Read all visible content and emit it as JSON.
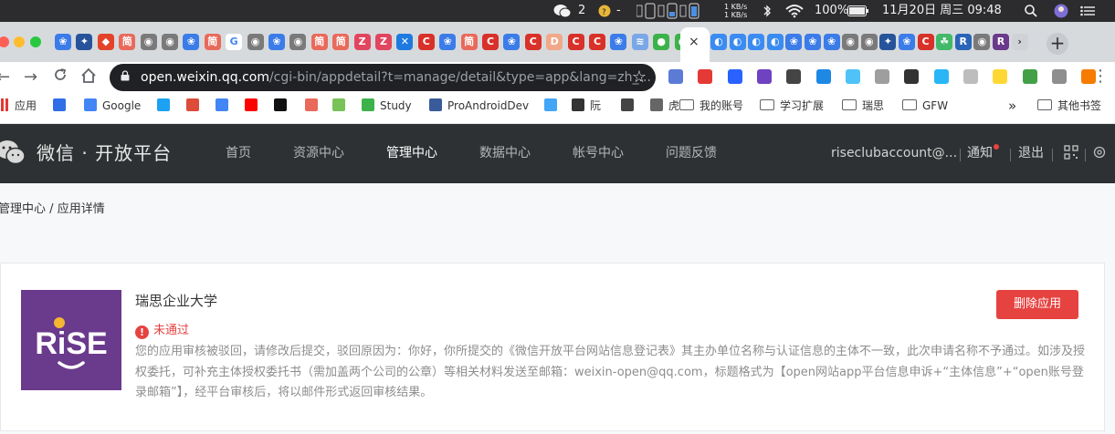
{
  "menubar": {
    "wechat_badge": "2",
    "weather_label": "-",
    "net_up": "1 KB/s",
    "net_down": "1 KB/s",
    "battery": "100%",
    "datetime": "11月20日 周三  09:48"
  },
  "tabs": {
    "favicons": [
      "baidu",
      "fox",
      "gitlab",
      "jian",
      "chrome-gray",
      "chrome-gray",
      "baidu",
      "jian",
      "google",
      "chrome-gray",
      "baidu",
      "chrome-gray",
      "jian",
      "jian",
      "zhihu",
      "zhihu",
      "x-blue",
      "c-red",
      "baidu",
      "jian",
      "c-red",
      "baidu",
      "c-red",
      "d-orange",
      "c-red",
      "c-red",
      "baidu",
      "layers",
      "green",
      "green"
    ],
    "right_favicons": [
      "blue",
      "blue",
      "blue",
      "blue",
      "baidu",
      "baidu",
      "baidu",
      "gray",
      "gray",
      "fox",
      "baidu",
      "c-red",
      "green-leaf",
      "r-logo",
      "gray",
      "rise",
      "more"
    ],
    "close_icon": "×",
    "new_tab_icon": "+"
  },
  "toolbar": {
    "url_domain": "open.weixin.qq.com",
    "url_path": "/cgi-bin/appdetail?t=manage/detail&type=app&lang=zh_..."
  },
  "bookmarks": {
    "items": [
      {
        "label": "应用",
        "icon": "grid-icon"
      },
      {
        "label": "",
        "icon": "baidu-icon"
      },
      {
        "label": "Google",
        "icon": "google-icon"
      },
      {
        "label": "",
        "icon": "twitter-icon"
      },
      {
        "label": "",
        "icon": "google-plus-icon"
      },
      {
        "label": "",
        "icon": "translate-icon"
      },
      {
        "label": "",
        "icon": "youtube-icon"
      },
      {
        "label": "",
        "icon": "github-icon"
      },
      {
        "label": "",
        "icon": "jianshu-icon"
      },
      {
        "label": "",
        "icon": "android-icon"
      },
      {
        "label": "Study",
        "icon": "study-icon"
      },
      {
        "label": "ProAndroidDev",
        "icon": "proandroiddev-icon"
      },
      {
        "label": "",
        "icon": "flutter-icon"
      },
      {
        "label": "阮",
        "icon": "ruan-icon"
      },
      {
        "label": "",
        "icon": "globe-icon"
      },
      {
        "label": "虎",
        "icon": "hu-icon"
      },
      {
        "label": "我的账号",
        "icon": "folder-icon"
      },
      {
        "label": "学习扩展",
        "icon": "folder-icon"
      },
      {
        "label": "瑞思",
        "icon": "folder-icon"
      },
      {
        "label": "GFW",
        "icon": "folder-icon"
      }
    ],
    "overflow": "»",
    "other": "其他书签"
  },
  "site": {
    "logo_text": "微信 · 开放平台",
    "nav": [
      "首页",
      "资源中心",
      "管理中心",
      "数据中心",
      "帐号中心",
      "问题反馈"
    ],
    "active_nav": "管理中心",
    "account": "riseclubaccount@...",
    "notice": "通知",
    "logout": "退出"
  },
  "breadcrumb": {
    "parent": "管理中心",
    "separator": "/",
    "current": "应用详情"
  },
  "app": {
    "name": "瑞思企业大学",
    "logo_text": "RiSE",
    "status": "未通过",
    "reason": "您的应用审核被驳回，请修改后提交，驳回原因为：你好，你所提交的《微信开放平台网站信息登记表》其主办单位名称与认证信息的主体不一致，此次申请名称不予通过。如涉及授权委托，可补充主体授权委托书（需加盖两个公司的公章）等相关材料发送至邮箱：weixin-open@qq.com，标题格式为【open网站app平台信息申诉+“主体信息”+“open账号登录邮箱”】，经平台审核后，将以邮件形式返回审核结果。",
    "delete_button": "删除应用"
  },
  "colors": {
    "header_bg": "#2e3133",
    "danger": "#e64340",
    "app_logo_bg": "#6a3a8c"
  }
}
